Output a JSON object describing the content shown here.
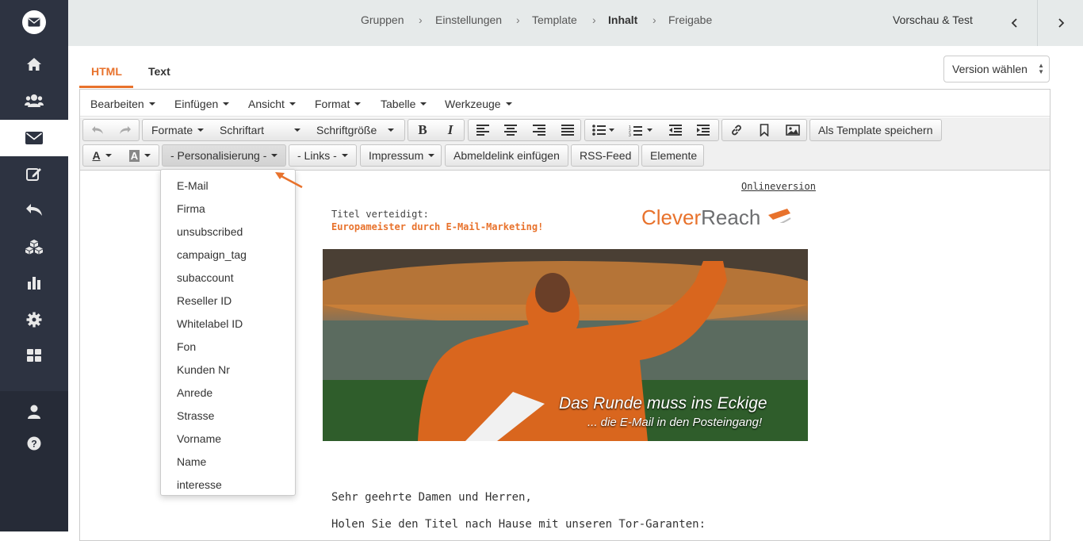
{
  "breadcrumb": {
    "items": [
      {
        "label": "Gruppen"
      },
      {
        "label": "Einstellungen"
      },
      {
        "label": "Template"
      },
      {
        "label": "Inhalt"
      },
      {
        "label": "Freigabe"
      }
    ],
    "preview_label": "Vorschau & Test"
  },
  "sidebar": {
    "items": [
      "home-icon",
      "users-icon",
      "mail-icon",
      "edit-icon",
      "reply-icon",
      "cubes-icon",
      "bar-chart-icon",
      "gear-icon",
      "grid-icon"
    ],
    "active": "mail-icon",
    "bottom_items": [
      "user-icon",
      "help-icon"
    ]
  },
  "tabs": {
    "html_label": "HTML",
    "text_label": "Text"
  },
  "version_select": {
    "value": "Version wählen"
  },
  "menubar": {
    "edit": "Bearbeiten",
    "insert": "Einfügen",
    "view": "Ansicht",
    "format": "Format",
    "table": "Tabelle",
    "tools": "Werkzeuge"
  },
  "toolbar": {
    "formats": "Formate",
    "font": "Schriftart",
    "font_size": "Schriftgröße",
    "save_template": "Als Template speichern",
    "personalization": "- Personalisierung -",
    "links": "- Links -",
    "imprint": "Impressum",
    "unsubscribe": "Abmeldelink einfügen",
    "rss": "RSS-Feed",
    "elements": "Elemente",
    "text_color_glyph": "A",
    "bg_color_glyph": "A"
  },
  "personalization_menu": {
    "items": [
      "E-Mail",
      "Firma",
      "unsubscribed",
      "campaign_tag",
      "subaccount",
      "Reseller ID",
      "Whitelabel ID",
      "Fon",
      "Kunden Nr",
      "Anrede",
      "Strasse",
      "Vorname",
      "Name",
      "interesse"
    ]
  },
  "content": {
    "online_version": "Onlineversion",
    "title_label": "Titel verteidigt:",
    "title_sub": "Europameister durch E-Mail-Marketing!",
    "brand_part1": "Clever",
    "brand_part2": "Reach",
    "hero_headline": "Das Runde muss ins Eckige",
    "hero_subline": "... die E-Mail in den Posteingang!",
    "greeting": "Sehr geehrte Damen und Herren,",
    "intro": "Holen Sie den Titel nach Hause mit unseren Tor-Garanten:"
  },
  "colors": {
    "accent": "#e8722c",
    "sidebar": "#2d3341",
    "topbar": "#e6eaea"
  }
}
